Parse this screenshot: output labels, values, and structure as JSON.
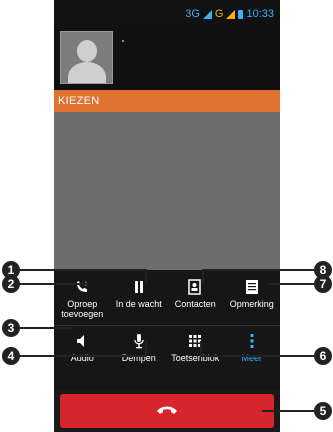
{
  "status": {
    "network": "3G",
    "network2": "G",
    "time": "10:33"
  },
  "call": {
    "label": "KIEZEN"
  },
  "controls": {
    "row1": [
      "Oproep toevoegen",
      "In de wacht",
      "Contacten",
      "Opmerking"
    ],
    "row2": [
      "Audio",
      "Dempen",
      "Toetsenblok",
      "Meer"
    ]
  },
  "badges": [
    "1",
    "2",
    "3",
    "4",
    "5",
    "6",
    "7",
    "8"
  ],
  "colors": {
    "accent": "#e0722f",
    "end": "#d7262b",
    "status": "#3ab0ff"
  },
  "icons": {
    "add_call": "add-call-icon",
    "hold": "pause-icon",
    "contacts": "contacts-icon",
    "note": "note-icon",
    "audio": "speaker-icon",
    "mute": "mic-icon",
    "keypad": "keypad-icon",
    "more": "more-icon",
    "end": "end-call-icon"
  }
}
